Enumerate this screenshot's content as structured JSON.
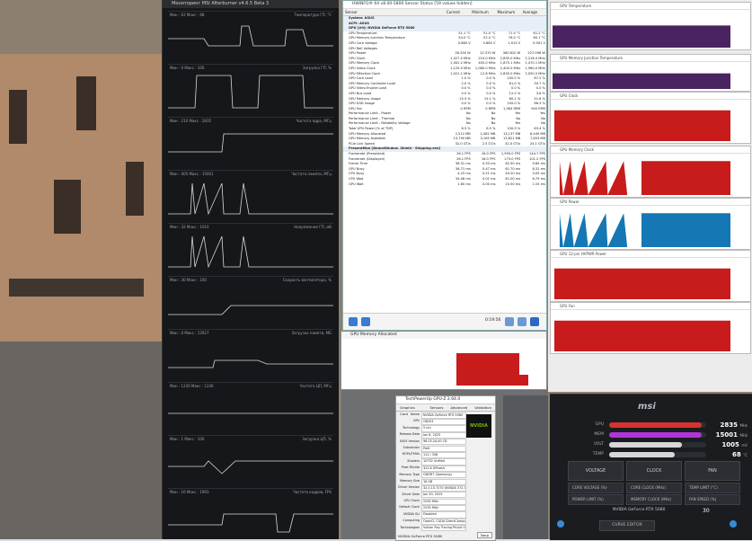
{
  "afterburner": {
    "title": "Мониторинг MSI Afterburner v4.6.5 Beta 3",
    "graphs": [
      {
        "left": "Мин : 62  Макс : 68",
        "right": "Температура ГП, °С"
      },
      {
        "left": "Мин : 0  Макс : 100",
        "right": "Загрузка ГП, %"
      },
      {
        "left": "Мин : 210  Макс : 2835",
        "right": "Частота ядра, МГц"
      },
      {
        "left": "Мин : 405  Макс : 15001",
        "right": "Частота памяти, МГц"
      },
      {
        "left": "Мин : 32  Макс : 1010",
        "right": "Напряжение ГП, мВ"
      },
      {
        "left": "Мин : 30  Макс : 100",
        "right": "Скорость вентилятора, %"
      },
      {
        "left": "Мин : 0  Макс : 12927",
        "right": "Загрузка памяти, МБ"
      },
      {
        "left": "Мин : 1230  Макс : 1230",
        "right": "Частота ЦП, МГц"
      },
      {
        "left": "Мин : 1  Макс : 100",
        "right": "Загрузка ЦП, %"
      },
      {
        "left": "Мин : 16  Макс : 1993",
        "right": "Частота кадров, FPS"
      }
    ]
  },
  "hwinfo": {
    "title": "HWiNFO® 64 v8.00-5800 Sensor Status [59 values hidden]",
    "columns": [
      "Sensor",
      "Current",
      "Minimum",
      "Maximum",
      "Average"
    ],
    "rows": [
      {
        "g": true,
        "n": "System: ASUS"
      },
      {
        "g": true,
        "n": "ACPI: ASUS"
      },
      {
        "g": true,
        "n": "GPU [#0]: NVIDIA GeForce RTX 5080"
      },
      {
        "n": "GPU Temperature",
        "c": "51.1 °C",
        "mi": "51.0 °C",
        "ma": "71.5 °C",
        "av": "61.2 °C"
      },
      {
        "n": "GPU Memory Junction Temperature",
        "c": "54.0 °C",
        "mi": "52.0 °C",
        "ma": "76.0 °C",
        "av": "65.7 °C"
      },
      {
        "n": "GPU Core Voltage",
        "c": "0.880 V",
        "mi": "0.880 V",
        "ma": "1.010 V",
        "av": "0.941 V"
      },
      {
        "n": "GPU Rail Voltages",
        "c": "",
        "mi": "",
        "ma": "",
        "av": ""
      },
      {
        "n": "GPU Power",
        "c": "26.350 W",
        "mi": "22.370 W",
        "ma": "360.820 W",
        "av": "227.098 W"
      },
      {
        "n": "GPU Clock",
        "c": "1,027.0 MHz",
        "mi": "210.0 MHz",
        "ma": "2,835.0 MHz",
        "av": "2,216.4 MHz"
      },
      {
        "n": "GPU Memory Clock",
        "c": "1,002.2 MHz",
        "mi": "405.0 MHz",
        "ma": "1,875.1 MHz",
        "av": "1,470.1 MHz"
      },
      {
        "n": "GPU Video Clock",
        "c": "1,125.0 MHz",
        "mi": "1,080.0 MHz",
        "ma": "2,400.0 MHz",
        "av": "1,960.0 MHz"
      },
      {
        "n": "GPU Effective Clock",
        "c": "1,021.1 MHz",
        "mi": "12.8 MHz",
        "ma": "2,835.0 MHz",
        "av": "2,050.5 MHz"
      },
      {
        "n": "GPU Core Load",
        "c": "1.0 %",
        "mi": "0.0 %",
        "ma": "100.0 %",
        "av": "67.2 %"
      },
      {
        "n": "GPU Memory Controller Load",
        "c": "2.0 %",
        "mi": "0.0 %",
        "ma": "61.0 %",
        "av": "34.7 %"
      },
      {
        "n": "GPU Video Engine Load",
        "c": "0.0 %",
        "mi": "0.0 %",
        "ma": "0.0 %",
        "av": "0.0 %"
      },
      {
        "n": "GPU Bus Load",
        "c": "0.0 %",
        "mi": "0.0 %",
        "ma": "12.0 %",
        "av": "3.8 %"
      },
      {
        "n": "GPU Memory Usage",
        "c": "15.3 %",
        "mi": "15.1 %",
        "ma": "80.2 %",
        "av": "51.6 %"
      },
      {
        "n": "GPU D3D Usage",
        "c": "0.0 %",
        "mi": "0.0 %",
        "ma": "100.0 %",
        "av": "66.3 %"
      },
      {
        "n": "GPU Fan",
        "c": "0 RPM",
        "mi": "0 RPM",
        "ma": "1,563 RPM",
        "av": "905 RPM"
      },
      {
        "n": "Performance Limit - Power",
        "c": "No",
        "mi": "No",
        "ma": "Yes",
        "av": "Yes"
      },
      {
        "n": "Performance Limit - Thermal",
        "c": "No",
        "mi": "No",
        "ma": "No",
        "av": "No"
      },
      {
        "n": "Performance Limit - Reliability Voltage",
        "c": "No",
        "mi": "No",
        "ma": "Yes",
        "av": "No"
      },
      {
        "n": "Total GPU Power [% of TDP]",
        "c": "8.3 %",
        "mi": "6.5 %",
        "ma": "100.9 %",
        "av": "63.4 %"
      },
      {
        "n": "GPU Memory Allocated",
        "c": "2,512 MB",
        "mi": "2,481 MB",
        "ma": "13,137 MB",
        "av": "8,449 MB"
      },
      {
        "n": "GPU Memory Available",
        "c": "13,790 MB",
        "mi": "3,165 MB",
        "ma": "13,821 MB",
        "av": "7,853 MB"
      },
      {
        "n": "PCIe Link Speed",
        "c": "32.0 GT/s",
        "mi": "2.5 GT/s",
        "ma": "32.0 GT/s",
        "av": "24.1 GT/s"
      },
      {
        "g": true,
        "n": "PresentMon [DemoWindow.  Shield - Shipping.exe]"
      },
      {
        "n": "Framerate (Presented)",
        "c": "26.1 FPS",
        "mi": "16.0 FPS",
        "ma": "1,993.0 FPS",
        "av": "144.7 FPS"
      },
      {
        "n": "Framerate (Displayed)",
        "c": "26.1 FPS",
        "mi": "16.0 FPS",
        "ma": "173.0 FPS",
        "av": "101.2 FPS"
      },
      {
        "n": "Frame Time",
        "c": "38.31 ms",
        "mi": "0.50 ms",
        "ma": "62.50 ms",
        "av": "9.84 ms"
      },
      {
        "n": "GPU Busy",
        "c": "36.71 ms",
        "mi": "0.47 ms",
        "ma": "61.70 ms",
        "av": "8.31 ms"
      },
      {
        "n": "CPU Busy",
        "c": "4.25 ms",
        "mi": "0.21 ms",
        "ma": "40.20 ms",
        "av": "3.05 ms"
      },
      {
        "n": "CPU Wait",
        "c": "34.06 ms",
        "mi": "0.01 ms",
        "ma": "61.00 ms",
        "av": "6.79 ms"
      },
      {
        "n": "GPU Wait",
        "c": "1.60 ms",
        "mi": "0.00 ms",
        "ma": "10.50 ms",
        "av": "1.53 ms"
      }
    ],
    "footer_time": "0:19:56"
  },
  "graph_window": {
    "title": "GPU Memory Allocated"
  },
  "gpuz": {
    "title": "TechPowerUp GPU-Z 2.64.0",
    "tabs": [
      "Graphics Card",
      "Sensors",
      "Advanced",
      "Validation"
    ],
    "rows": [
      {
        "k": "Name",
        "v": "NVIDIA GeForce RTX 5080"
      },
      {
        "k": "GPU",
        "v": "GB203"
      },
      {
        "k": "Technology",
        "v": "5 nm"
      },
      {
        "k": "Release Date",
        "v": "Jan 8, 2025"
      },
      {
        "k": "BIOS Version",
        "v": "98.03.2A.00.7D"
      },
      {
        "k": "Subvendor",
        "v": "Palit"
      },
      {
        "k": "ROPs/TMUs",
        "v": "112 / 336"
      },
      {
        "k": "Shaders",
        "v": "10752 Unified"
      },
      {
        "k": "Pixel Fillrate",
        "v": "322.6 GPixel/s"
      },
      {
        "k": "Memory Type",
        "v": "GDDR7 (Samsung)"
      },
      {
        "k": "Memory Size",
        "v": "16 GB"
      },
      {
        "k": "Driver Version",
        "v": "32.0.15.7270 (NVIDIA 572.70) DCH / Win11 64"
      },
      {
        "k": "Driver Date",
        "v": "Jan 30, 2025"
      },
      {
        "k": "GPU Clock",
        "v": "2295 MHz"
      },
      {
        "k": "Default Clock",
        "v": "2295 MHz"
      },
      {
        "k": "NVIDIA SLI",
        "v": "Disabled"
      },
      {
        "k": "Computing",
        "v": "OpenCL  CUDA  DirectCompute  DirectML"
      },
      {
        "k": "Technologies",
        "v": "Vulkan  Ray Tracing  PhysX  OpenGL 4.6"
      }
    ],
    "footer": "NVIDIA GeForce RTX 5080",
    "close": "Закр",
    "logo": "NVIDIA"
  },
  "right_monitor": {
    "panels": [
      {
        "title": "GPU Temperature"
      },
      {
        "title": "GPU Memory Junction Temperature"
      },
      {
        "title": "GPU Clock"
      },
      {
        "title": "GPU Memory Clock"
      },
      {
        "title": "GPU Power"
      },
      {
        "title": "GPU 12-pin HVPWR Power"
      },
      {
        "title": "GPU Fan"
      }
    ]
  },
  "msi": {
    "logo": "msi",
    "rows": [
      {
        "label": "GPU",
        "value": "2835",
        "unit": "MHz",
        "color": "#d73232",
        "frac": 0.95
      },
      {
        "label": "MEM",
        "value": "15001",
        "unit": "MHz",
        "color": "#b034d8",
        "frac": 0.95
      },
      {
        "label": "VOLT",
        "value": "1005",
        "unit": "mV",
        "color": "#d7d7d7",
        "frac": 0.75
      },
      {
        "label": "TEMP",
        "value": "68",
        "unit": "°C",
        "color": "#d7d7d7",
        "frac": 0.68
      }
    ],
    "tabs": [
      "VOLTAGE",
      "CLOCK",
      "FAN"
    ],
    "controls": [
      "CORE VOLTAGE (%)",
      "POWER LIMIT (%)",
      "CORE CLOCK (MHz)",
      "MEMORY CLOCK (MHz)",
      "TEMP LIMIT (°C)",
      "FAN SPEED (%)"
    ],
    "gpu_name": "NVIDIA GeForce RTX 5080",
    "curve_editor": "CURVE EDITOR",
    "fan_speed_val": "30"
  },
  "colors": {
    "red": "#c81c1c",
    "blue": "#1577b3",
    "purple": "#4a2460"
  }
}
